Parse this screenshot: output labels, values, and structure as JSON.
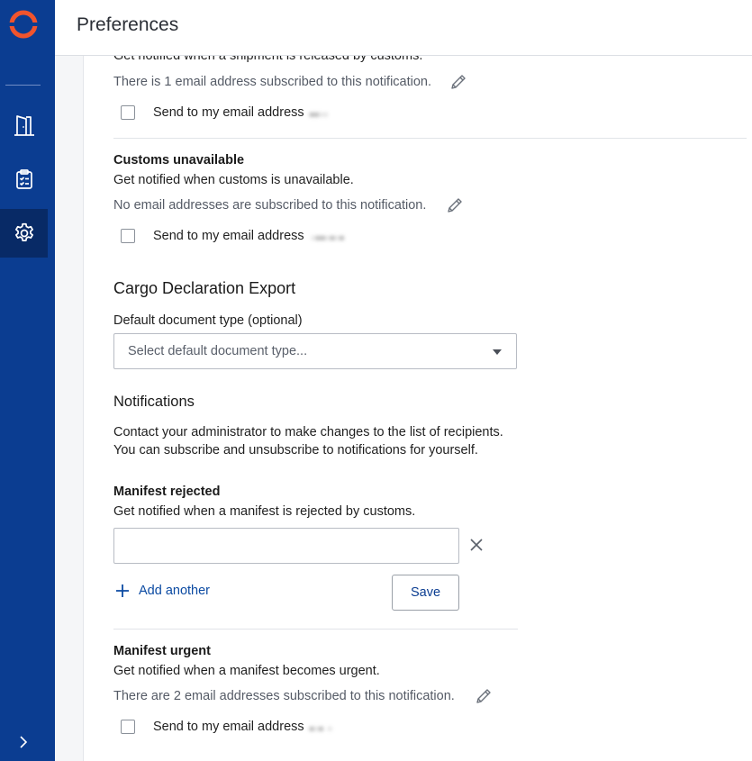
{
  "header": {
    "title": "Preferences"
  },
  "sections": {
    "shipment_released": {
      "description": "Get notified when a shipment is released by customs.",
      "subscribed_text": "There is 1 email address subscribed to this notification.",
      "send_label": "Send to my email address"
    },
    "customs_unavailable": {
      "title": "Customs unavailable",
      "description": "Get notified when customs is unavailable.",
      "subscribed_text": "No email addresses are subscribed to this notification.",
      "send_label": "Send to my email address"
    },
    "cargo_export": {
      "title": "Cargo Declaration Export",
      "doc_type_label": "Default document type (optional)",
      "doc_type_placeholder": "Select default document type..."
    },
    "notifications": {
      "title": "Notifications",
      "line1": "Contact your administrator to make changes to the list of recipients.",
      "line2": "You can subscribe and unsubscribe to notifications for yourself."
    },
    "manifest_rejected": {
      "title": "Manifest rejected",
      "description": "Get notified when a manifest is rejected by customs.",
      "email_value": "",
      "add_another": "Add another",
      "save": "Save"
    },
    "manifest_urgent": {
      "title": "Manifest urgent",
      "description": "Get notified when a manifest becomes urgent.",
      "subscribed_text": "There are 2 email addresses subscribed to this notification.",
      "send_label": "Send to my email address"
    }
  },
  "colors": {
    "sidebar": "#0b3d91",
    "sidebar_active": "#082a66",
    "logo_accent": "#f0542d",
    "link": "#0b4aa2"
  },
  "icons": [
    "logo-icon",
    "door-icon",
    "clipboard-icon",
    "gear-icon",
    "pencil-icon",
    "close-icon",
    "plus-icon",
    "chevron-right-icon"
  ]
}
